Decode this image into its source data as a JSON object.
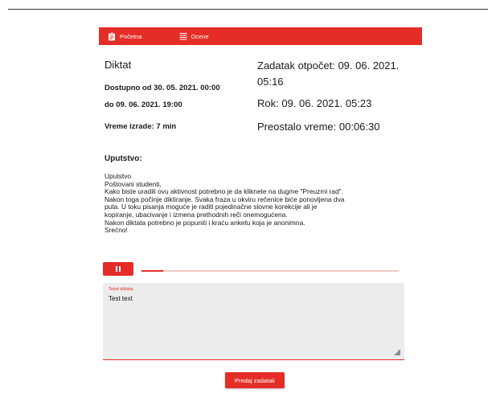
{
  "nav": {
    "home_label": "Početna",
    "home_icon": "clipboard-icon",
    "grades_label": "Ocene",
    "grades_icon": "list-icon"
  },
  "task": {
    "title": "Diktat",
    "available_from": "Dostupno od 30. 05. 2021. 00:00",
    "available_to": "do 09. 06. 2021. 19:00",
    "duration": "Vreme izrade: 7 min",
    "started": "Zadatak otpočet: 09. 06. 2021. 05:16",
    "deadline": "Rok: 09. 06. 2021. 05:23",
    "remaining": "Preostalo vreme: 00:06:30"
  },
  "instructions": {
    "heading": "Uputstvo:",
    "lines": [
      "Uputstvo",
      "Poštovani studenti,",
      "Kako biste uradili ovu aktivnost potrebno je da kliknete na dugme \"Preuzmi rad\".",
      "Nakon toga počinje diktiranje. Svaka fraza u okviru rečenice biće ponovljena dva",
      "puta. U toku pisanja moguće je raditi pojedinačne slovne korekcije ali je",
      "kopiranje, ubacivanje i izmena prethodnih reči onemogućena.",
      "Nakon diktata potrebno je popuniti i kraću anketu koja je anonimna.",
      "Srećno!"
    ]
  },
  "player": {
    "pause_icon": "pause-icon",
    "progress_fraction": 0.085
  },
  "answer_field": {
    "label": "Tekst diktata",
    "value": "Test text"
  },
  "submit_label": "Predaj zadatak",
  "colors": {
    "accent": "#e52d27",
    "field_bg": "#ececec"
  }
}
